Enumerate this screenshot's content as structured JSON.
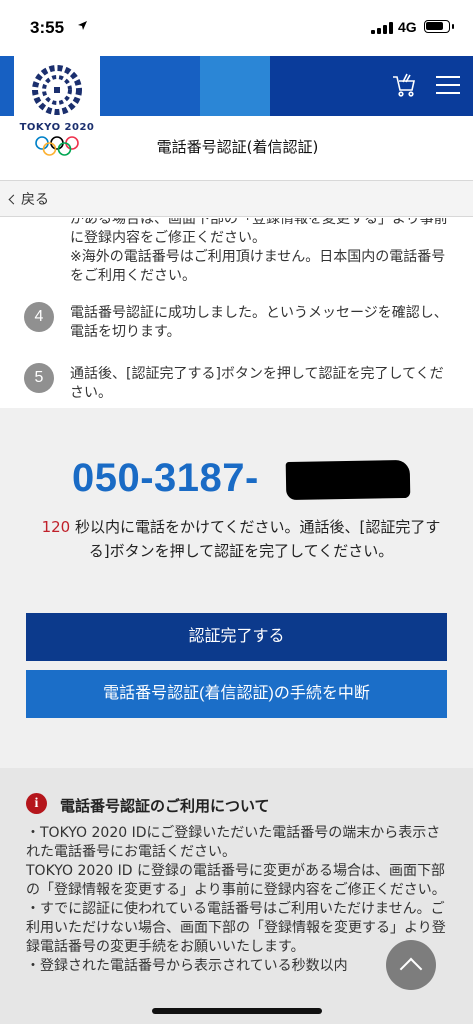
{
  "status_bar": {
    "time": "3:55",
    "location_arrow": "location-arrow-icon",
    "network": "4G"
  },
  "header": {
    "logo_text": "TOKYO 2020",
    "cart_icon": "cart-icon",
    "menu_icon": "hamburger-menu-icon",
    "page_title": "電話番号認証(着信認証)",
    "colors": {
      "navy": "#0a3c9b",
      "blue": "#1760c2",
      "light_blue": "#2b86d6"
    }
  },
  "nav": {
    "back_label": "戻る"
  },
  "steps": {
    "continued_text": "がある場合は、画面下部の「登録情報を変更する」より事前に登録内容をご修正ください。\n※海外の電話番号はご利用頂けません。日本国内の電話番号をご利用ください。",
    "items": [
      {
        "number": "4",
        "text": "電話番号認証に成功しました。というメッセージを確認し、電話を切ります。"
      },
      {
        "number": "5",
        "text": "通話後、[認証完了する]ボタンを押して認証を完了してください。"
      }
    ]
  },
  "phone": {
    "number": "050-3187-",
    "countdown": "120",
    "instruction_after": " 秒以内に電話をかけてください。通話後、[認証完了する]ボタンを押して認証を完了してください。"
  },
  "buttons": {
    "complete": "認証完了する",
    "abort": "電話番号認証(着信認証)の手続を中断"
  },
  "notice": {
    "icon": "info-icon",
    "title": "電話番号認証のご利用について",
    "body": "・TOKYO 2020 IDにご登録いただいた電話番号の端末から表示された電話番号にお電話ください。\nTOKYO 2020 ID に登録の電話番号に変更がある場合は、画面下部の「登録情報を変更する」より事前に登録内容をご修正ください。\n・すでに認証に使われている電話番号はご利用いただけません。ご利用いただけない場合、画面下部の「登録情報を変更する」より登録電話番号の変更手続をお願いいたします。\n・登録された電話番号から表示されている秒数以内"
  },
  "scroll_top_icon": "arrow-up-icon"
}
